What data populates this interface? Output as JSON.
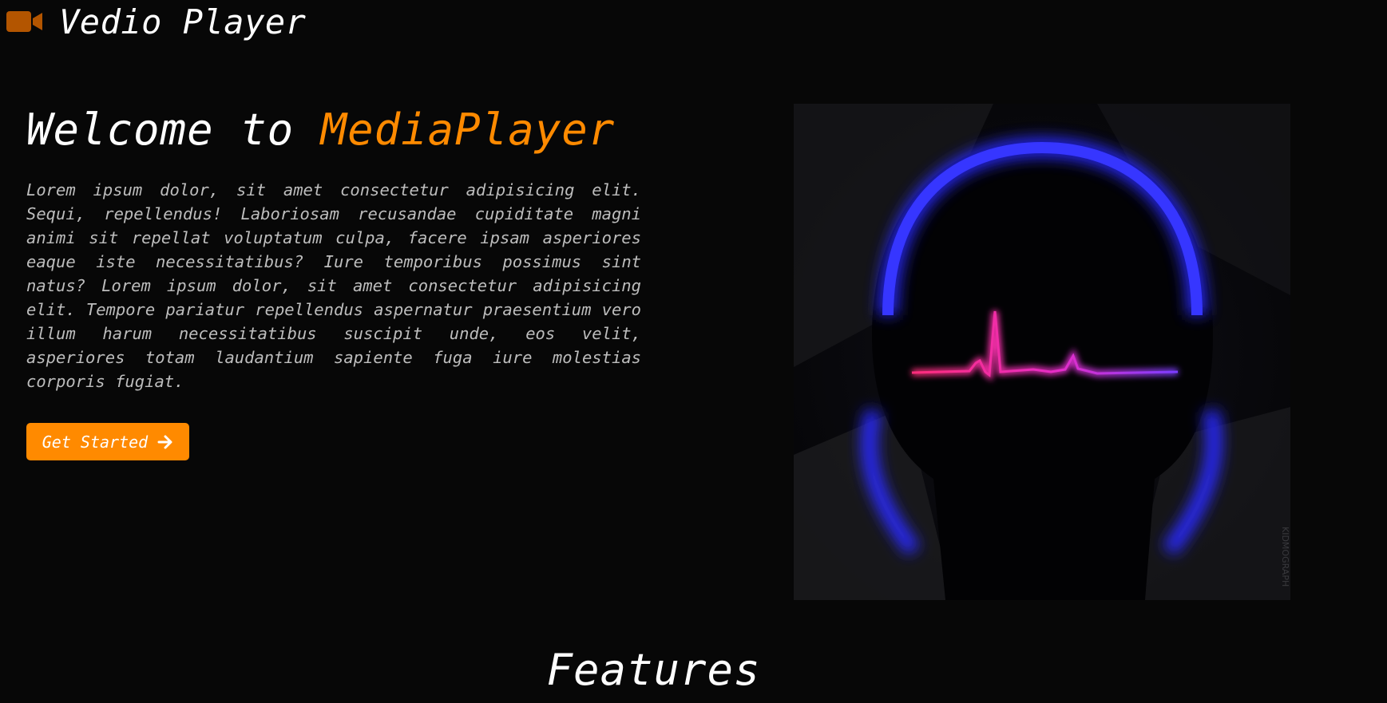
{
  "nav": {
    "icon": "video-camera-icon",
    "brand": "Vedio Player"
  },
  "hero": {
    "title_prefix": "Welcome to ",
    "title_accent": "MediaPlayer",
    "description": "Lorem ipsum dolor, sit amet consectetur adipisicing elit. Sequi, repellendus! Laboriosam recusandae cupiditate magni animi sit repellat voluptatum culpa, facere ipsam asperiores eaque iste necessitatibus? Iure temporibus possimus sint natus? Lorem ipsum dolor, sit amet consectetur adipisicing elit. Tempore pariatur repellendus aspernatur praesentium vero illum harum necessitatibus suscipit unde, eos velit, asperiores totam laudantium sapiente fuga iure molestias corporis fugiat.",
    "cta_label": "Get Started",
    "cta_icon": "arrow-right-icon",
    "image_watermark": "KIDMOGRAPH"
  },
  "features": {
    "title": "Features"
  },
  "colors": {
    "accent": "#ff8a00",
    "background": "#070707",
    "text_muted": "#bdbdbd",
    "headphone_blue": "#2a2aff",
    "pulse_pink": "#ff2d9a"
  }
}
